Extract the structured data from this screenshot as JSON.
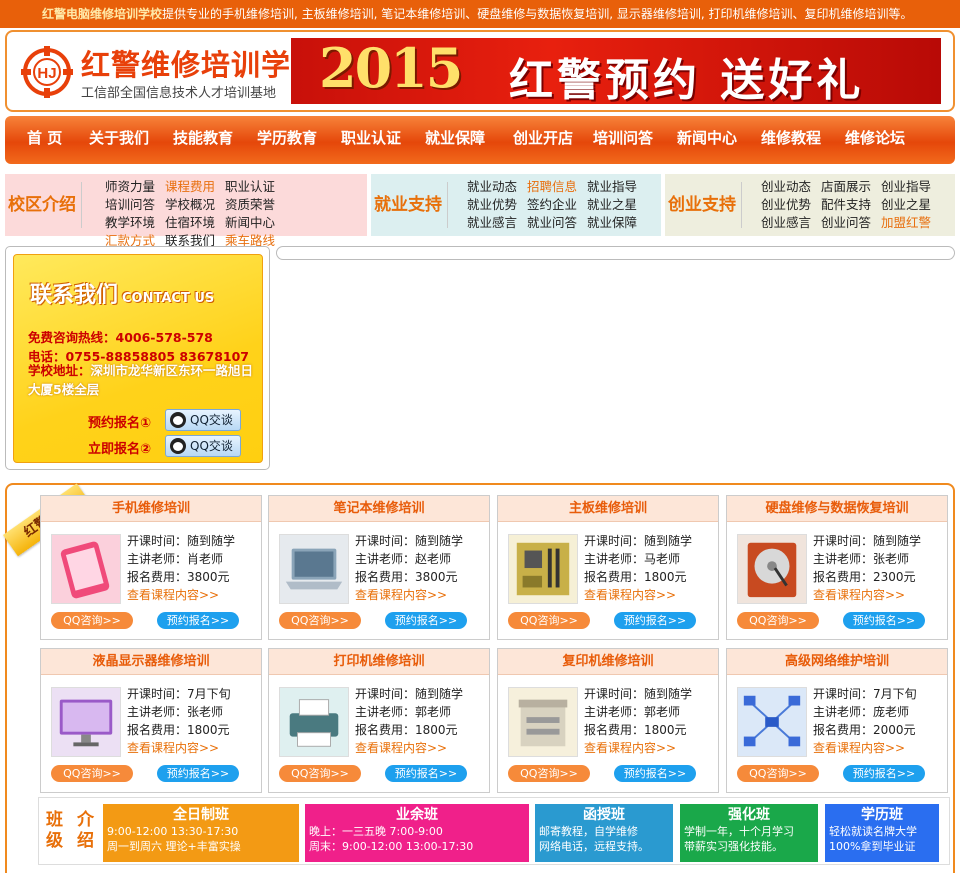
{
  "topbar": {
    "brand": "红警电脑维修培训学校",
    "text": "提供专业的手机维修培训, 主板维修培训, 笔记本维修培训、硬盘维修与数据恢复培训, 显示器维修培训, 打印机维修培训、复印机维修培训等。"
  },
  "header": {
    "school_name": "红警维修培训学校",
    "subtitle": "工信部全国信息技术人才培训基地",
    "banner_year": "2015",
    "banner_slogan": "红警预约 送好礼"
  },
  "nav": [
    "首 页",
    "关于我们",
    "技能教育",
    "学历教育",
    "职业认证",
    "就业保障",
    "创业开店",
    "培训问答",
    "新闻中心",
    "维修教程",
    "维修论坛"
  ],
  "quick": [
    {
      "title": "校区介绍",
      "links": [
        [
          "师资力量",
          "课程费用",
          "职业认证",
          "培训问答"
        ],
        [
          "学校概况",
          "资质荣誉",
          "教学环境",
          "住宿环境"
        ],
        [
          "新闻中心",
          "汇款方式",
          "联系我们",
          "乘车路线"
        ]
      ],
      "highlight": [
        "课程费用",
        "汇款方式",
        "乘车路线"
      ]
    },
    {
      "title": "就业支持",
      "links": [
        [
          "就业动态",
          "招聘信息",
          "就业指导"
        ],
        [
          "就业优势",
          "签约企业",
          "就业之星"
        ],
        [
          "就业感言",
          "就业问答",
          "就业保障"
        ]
      ],
      "highlight": [
        "招聘信息"
      ]
    },
    {
      "title": "创业支持",
      "links": [
        [
          "创业动态",
          "店面展示",
          "创业指导"
        ],
        [
          "创业优势",
          "配件支持",
          "创业之星"
        ],
        [
          "创业感言",
          "创业问答",
          "加盟红警"
        ]
      ],
      "highlight": [
        "加盟红警"
      ]
    }
  ],
  "contact": {
    "title": "联系我们",
    "title_en": "CONTACT US",
    "hotline_label": "免费咨询热线：",
    "hotline": "4006-578-578",
    "phone_label": "电话：",
    "phone": "0755-88858805 83678107",
    "address_label": "学校地址：",
    "address": "深圳市龙华新区东环一路旭日大厦5楼全层",
    "reg1": "预约报名①",
    "reg2": "立即报名②",
    "qq_label": "QQ交谈"
  },
  "courses_ribbon": "红警课程",
  "course_labels": {
    "time": "开课时间：",
    "teacher": "主讲老师：",
    "fee": "报名费用：",
    "more": "查看课程内容>>",
    "consult": "QQ咨询>>",
    "signup": "预约报名>>"
  },
  "courses": [
    {
      "name": "手机维修培训",
      "time": "随到随学",
      "teacher": "肖老师",
      "fee": "3800元",
      "icon": "phone"
    },
    {
      "name": "笔记本维修培训",
      "time": "随到随学",
      "teacher": "赵老师",
      "fee": "3800元",
      "icon": "laptop"
    },
    {
      "name": "主板维修培训",
      "time": "随到随学",
      "teacher": "马老师",
      "fee": "1800元",
      "icon": "motherboard"
    },
    {
      "name": "硬盘维修与数据恢复培训",
      "time": "随到随学",
      "teacher": "张老师",
      "fee": "2300元",
      "icon": "harddisk"
    },
    {
      "name": "液晶显示器维修培训",
      "time": "7月下旬",
      "teacher": "张老师",
      "fee": "1800元",
      "icon": "monitor"
    },
    {
      "name": "打印机维修培训",
      "time": "随到随学",
      "teacher": "郭老师",
      "fee": "1800元",
      "icon": "printer"
    },
    {
      "name": "复印机维修培训",
      "time": "随到随学",
      "teacher": "郭老师",
      "fee": "1800元",
      "icon": "copier"
    },
    {
      "name": "高级网络维护培训",
      "time": "7月下旬",
      "teacher": "庞老师",
      "fee": "2000元",
      "icon": "network"
    }
  ],
  "classes": {
    "title": "班级介绍",
    "items": [
      {
        "name": "全日制班",
        "lines": [
          "9:00-12:00 13:30-17:30",
          "周一到周六 理论+丰富实操"
        ],
        "color": "#f39a14"
      },
      {
        "name": "业余班",
        "lines": [
          "晚上：一三五晚 7:00-9:00",
          "周末：9:00-12:00 13:00-17:30"
        ],
        "color": "#f0208a"
      },
      {
        "name": "函授班",
        "lines": [
          "邮寄教程，自学维修",
          "网络电话，远程支持。"
        ],
        "color": "#2a9ad0"
      },
      {
        "name": "强化班",
        "lines": [
          "学制一年，十个月学习",
          "带薪实习强化技能。"
        ],
        "color": "#1aa84a"
      },
      {
        "name": "学历班",
        "lines": [
          "轻松就读名牌大学",
          "100%拿到毕业证"
        ],
        "color": "#2a6ef0"
      }
    ]
  }
}
